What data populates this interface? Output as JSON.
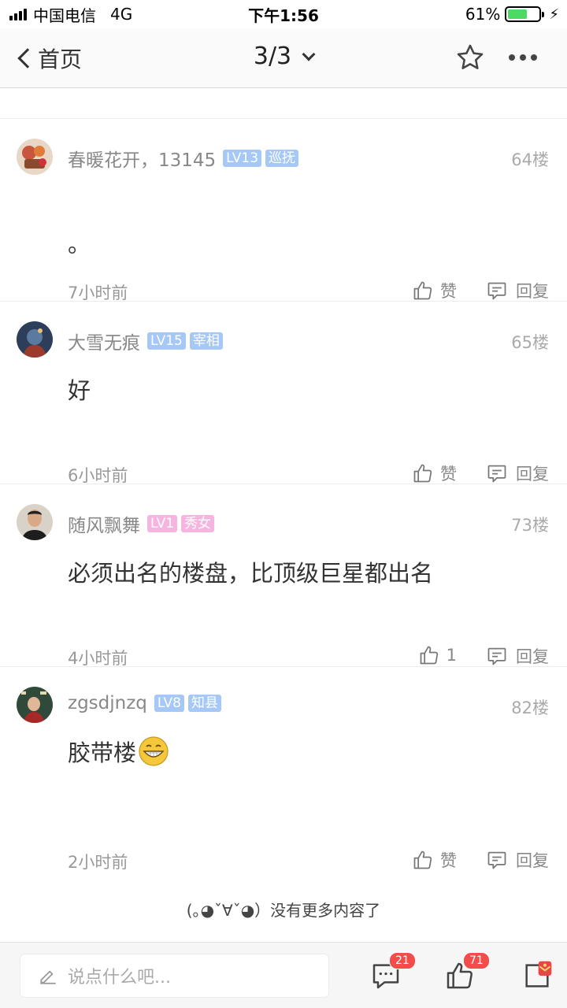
{
  "status_bar": {
    "carrier": "中国电信",
    "network": "4G",
    "time": "下午1:56",
    "battery_percent": "61%",
    "battery_level": 0.61
  },
  "nav": {
    "back_label": "首页",
    "page_indicator": "3/3",
    "icons": [
      "chevron-left-icon",
      "chevron-down-icon",
      "star-icon",
      "more-icon"
    ]
  },
  "comments": [
    {
      "user": "春暖花开，13145",
      "level": "LV13",
      "title": "巡抚",
      "floor": "64楼",
      "text": "。",
      "time": "7小时前",
      "like_label": "赞",
      "reply_label": "回复",
      "avatar_color": "#c8553d"
    },
    {
      "user": "大雪无痕",
      "level": "LV15",
      "title": "宰相",
      "floor": "65楼",
      "text": "好",
      "time": "6小时前",
      "like_label": "赞",
      "reply_label": "回复",
      "avatar_color": "#3a5a78"
    },
    {
      "user": "随风飘舞",
      "level": "LV1",
      "title": "秀女",
      "floor": "73楼",
      "text": "必须出名的楼盘，比顶级巨星都出名",
      "time": "4小时前",
      "like_label": "1",
      "reply_label": "回复",
      "avatar_color": "#b9a48e"
    },
    {
      "user": "zgsdjnzq",
      "level": "LV8",
      "title": "知县",
      "floor": "82楼",
      "text": "胶带楼",
      "time": "2小时前",
      "like_label": "赞",
      "reply_label": "回复",
      "avatar_color": "#2f4a3a",
      "emoji": "grin-emoji"
    }
  ],
  "footer_note": "(｡◕ˇ∀ˇ◕）没有更多内容了",
  "bottom_bar": {
    "input_placeholder": "说点什么吧...",
    "comment_count": "21",
    "like_count": "71",
    "icons": [
      "pencil-icon",
      "comment-icon",
      "thumb-up-icon",
      "share-icon"
    ]
  },
  "colors": {
    "badge_blue": "#a6c8f6",
    "badge_pink": "#f6b5e0",
    "count_badge": "#f44b4b",
    "battery": "#4cd964"
  }
}
